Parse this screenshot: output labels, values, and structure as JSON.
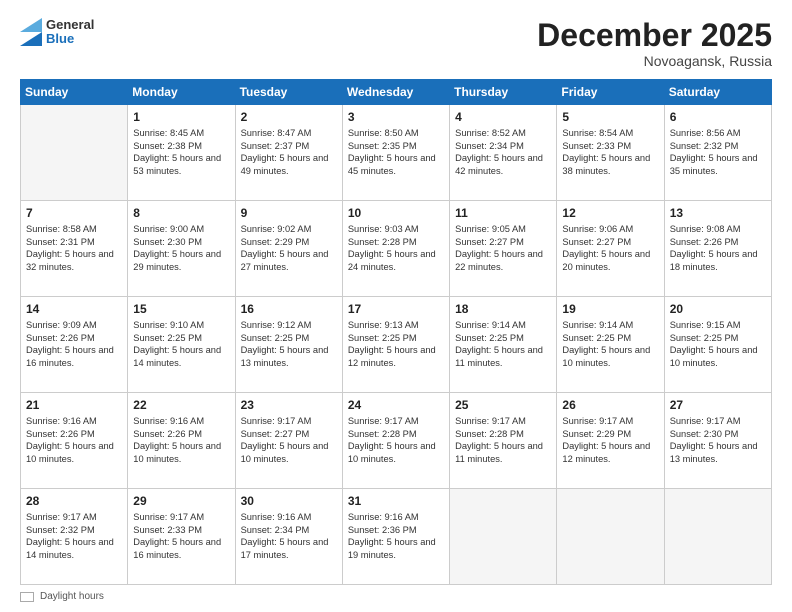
{
  "header": {
    "logo_general": "General",
    "logo_blue": "Blue",
    "month_title": "December 2025",
    "location": "Novoagansk, Russia"
  },
  "footer": {
    "label": "Daylight hours"
  },
  "weekdays": [
    "Sunday",
    "Monday",
    "Tuesday",
    "Wednesday",
    "Thursday",
    "Friday",
    "Saturday"
  ],
  "weeks": [
    [
      {
        "day": "",
        "empty": true
      },
      {
        "day": "1",
        "sunrise": "Sunrise: 8:45 AM",
        "sunset": "Sunset: 2:38 PM",
        "daylight": "Daylight: 5 hours and 53 minutes."
      },
      {
        "day": "2",
        "sunrise": "Sunrise: 8:47 AM",
        "sunset": "Sunset: 2:37 PM",
        "daylight": "Daylight: 5 hours and 49 minutes."
      },
      {
        "day": "3",
        "sunrise": "Sunrise: 8:50 AM",
        "sunset": "Sunset: 2:35 PM",
        "daylight": "Daylight: 5 hours and 45 minutes."
      },
      {
        "day": "4",
        "sunrise": "Sunrise: 8:52 AM",
        "sunset": "Sunset: 2:34 PM",
        "daylight": "Daylight: 5 hours and 42 minutes."
      },
      {
        "day": "5",
        "sunrise": "Sunrise: 8:54 AM",
        "sunset": "Sunset: 2:33 PM",
        "daylight": "Daylight: 5 hours and 38 minutes."
      },
      {
        "day": "6",
        "sunrise": "Sunrise: 8:56 AM",
        "sunset": "Sunset: 2:32 PM",
        "daylight": "Daylight: 5 hours and 35 minutes."
      }
    ],
    [
      {
        "day": "7",
        "sunrise": "Sunrise: 8:58 AM",
        "sunset": "Sunset: 2:31 PM",
        "daylight": "Daylight: 5 hours and 32 minutes."
      },
      {
        "day": "8",
        "sunrise": "Sunrise: 9:00 AM",
        "sunset": "Sunset: 2:30 PM",
        "daylight": "Daylight: 5 hours and 29 minutes."
      },
      {
        "day": "9",
        "sunrise": "Sunrise: 9:02 AM",
        "sunset": "Sunset: 2:29 PM",
        "daylight": "Daylight: 5 hours and 27 minutes."
      },
      {
        "day": "10",
        "sunrise": "Sunrise: 9:03 AM",
        "sunset": "Sunset: 2:28 PM",
        "daylight": "Daylight: 5 hours and 24 minutes."
      },
      {
        "day": "11",
        "sunrise": "Sunrise: 9:05 AM",
        "sunset": "Sunset: 2:27 PM",
        "daylight": "Daylight: 5 hours and 22 minutes."
      },
      {
        "day": "12",
        "sunrise": "Sunrise: 9:06 AM",
        "sunset": "Sunset: 2:27 PM",
        "daylight": "Daylight: 5 hours and 20 minutes."
      },
      {
        "day": "13",
        "sunrise": "Sunrise: 9:08 AM",
        "sunset": "Sunset: 2:26 PM",
        "daylight": "Daylight: 5 hours and 18 minutes."
      }
    ],
    [
      {
        "day": "14",
        "sunrise": "Sunrise: 9:09 AM",
        "sunset": "Sunset: 2:26 PM",
        "daylight": "Daylight: 5 hours and 16 minutes."
      },
      {
        "day": "15",
        "sunrise": "Sunrise: 9:10 AM",
        "sunset": "Sunset: 2:25 PM",
        "daylight": "Daylight: 5 hours and 14 minutes."
      },
      {
        "day": "16",
        "sunrise": "Sunrise: 9:12 AM",
        "sunset": "Sunset: 2:25 PM",
        "daylight": "Daylight: 5 hours and 13 minutes."
      },
      {
        "day": "17",
        "sunrise": "Sunrise: 9:13 AM",
        "sunset": "Sunset: 2:25 PM",
        "daylight": "Daylight: 5 hours and 12 minutes."
      },
      {
        "day": "18",
        "sunrise": "Sunrise: 9:14 AM",
        "sunset": "Sunset: 2:25 PM",
        "daylight": "Daylight: 5 hours and 11 minutes."
      },
      {
        "day": "19",
        "sunrise": "Sunrise: 9:14 AM",
        "sunset": "Sunset: 2:25 PM",
        "daylight": "Daylight: 5 hours and 10 minutes."
      },
      {
        "day": "20",
        "sunrise": "Sunrise: 9:15 AM",
        "sunset": "Sunset: 2:25 PM",
        "daylight": "Daylight: 5 hours and 10 minutes."
      }
    ],
    [
      {
        "day": "21",
        "sunrise": "Sunrise: 9:16 AM",
        "sunset": "Sunset: 2:26 PM",
        "daylight": "Daylight: 5 hours and 10 minutes."
      },
      {
        "day": "22",
        "sunrise": "Sunrise: 9:16 AM",
        "sunset": "Sunset: 2:26 PM",
        "daylight": "Daylight: 5 hours and 10 minutes."
      },
      {
        "day": "23",
        "sunrise": "Sunrise: 9:17 AM",
        "sunset": "Sunset: 2:27 PM",
        "daylight": "Daylight: 5 hours and 10 minutes."
      },
      {
        "day": "24",
        "sunrise": "Sunrise: 9:17 AM",
        "sunset": "Sunset: 2:28 PM",
        "daylight": "Daylight: 5 hours and 10 minutes."
      },
      {
        "day": "25",
        "sunrise": "Sunrise: 9:17 AM",
        "sunset": "Sunset: 2:28 PM",
        "daylight": "Daylight: 5 hours and 11 minutes."
      },
      {
        "day": "26",
        "sunrise": "Sunrise: 9:17 AM",
        "sunset": "Sunset: 2:29 PM",
        "daylight": "Daylight: 5 hours and 12 minutes."
      },
      {
        "day": "27",
        "sunrise": "Sunrise: 9:17 AM",
        "sunset": "Sunset: 2:30 PM",
        "daylight": "Daylight: 5 hours and 13 minutes."
      }
    ],
    [
      {
        "day": "28",
        "sunrise": "Sunrise: 9:17 AM",
        "sunset": "Sunset: 2:32 PM",
        "daylight": "Daylight: 5 hours and 14 minutes."
      },
      {
        "day": "29",
        "sunrise": "Sunrise: 9:17 AM",
        "sunset": "Sunset: 2:33 PM",
        "daylight": "Daylight: 5 hours and 16 minutes."
      },
      {
        "day": "30",
        "sunrise": "Sunrise: 9:16 AM",
        "sunset": "Sunset: 2:34 PM",
        "daylight": "Daylight: 5 hours and 17 minutes."
      },
      {
        "day": "31",
        "sunrise": "Sunrise: 9:16 AM",
        "sunset": "Sunset: 2:36 PM",
        "daylight": "Daylight: 5 hours and 19 minutes."
      },
      {
        "day": "",
        "empty": true
      },
      {
        "day": "",
        "empty": true
      },
      {
        "day": "",
        "empty": true
      }
    ]
  ]
}
